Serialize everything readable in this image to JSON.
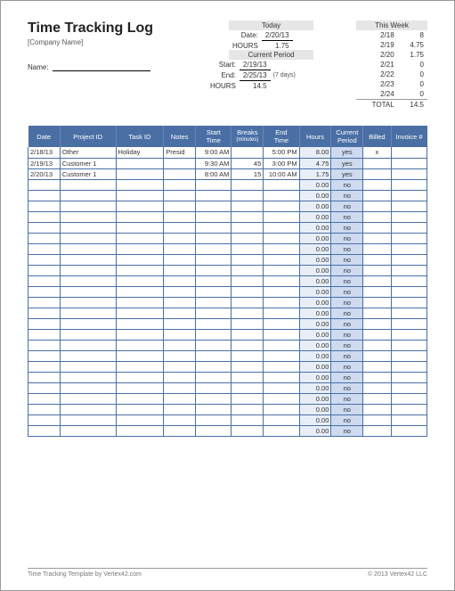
{
  "title": "Time Tracking Log",
  "company_placeholder": "[Company Name]",
  "name_label": "Name:",
  "today": {
    "heading": "Today",
    "date_label": "Date:",
    "date_value": "2/20/13",
    "hours_label": "HOURS",
    "hours_value": "1.75"
  },
  "current_period": {
    "heading": "Current Period",
    "start_label": "Start:",
    "start_value": "2/19/13",
    "end_label": "End:",
    "end_value": "2/25/13",
    "span_note": "(7 days)",
    "hours_label": "HOURS",
    "hours_value": "14.5"
  },
  "this_week": {
    "heading": "This Week",
    "rows": [
      {
        "d": "2/18",
        "v": "8"
      },
      {
        "d": "2/19",
        "v": "4.75"
      },
      {
        "d": "2/20",
        "v": "1.75"
      },
      {
        "d": "2/21",
        "v": "0"
      },
      {
        "d": "2/22",
        "v": "0"
      },
      {
        "d": "2/23",
        "v": "0"
      },
      {
        "d": "2/24",
        "v": "0"
      }
    ],
    "total_label": "TOTAL",
    "total_value": "14.5"
  },
  "columns": [
    "Date",
    "Project ID",
    "Task ID",
    "Notes",
    "Start\nTime",
    "Breaks",
    "End\nTime",
    "Hours",
    "Current\nPeriod",
    "Billed",
    "Invoice #"
  ],
  "breaks_sub": "(minutes)",
  "rows": [
    {
      "date": "2/18/13",
      "project": "Other",
      "task": "Holiday",
      "notes": "Presid",
      "start": "9:00 AM",
      "breaks": "",
      "end": "5:00 PM",
      "hours": "8.00",
      "period": "yes",
      "billed": "x",
      "invoice": ""
    },
    {
      "date": "2/19/13",
      "project": "Customer 1",
      "task": "",
      "notes": "",
      "start": "9:30 AM",
      "breaks": "45",
      "end": "3:00 PM",
      "hours": "4.75",
      "period": "yes",
      "billed": "",
      "invoice": ""
    },
    {
      "date": "2/20/13",
      "project": "Customer 1",
      "task": "",
      "notes": "",
      "start": "8:00 AM",
      "breaks": "15",
      "end": "10:00 AM",
      "hours": "1.75",
      "period": "yes",
      "billed": "",
      "invoice": ""
    }
  ],
  "empty_rows": 24,
  "empty_hours": "0.00",
  "empty_period": "no",
  "footer_left": "Time Tracking Template by Vertex42.com",
  "footer_right": "© 2013 Vertex42 LLC"
}
